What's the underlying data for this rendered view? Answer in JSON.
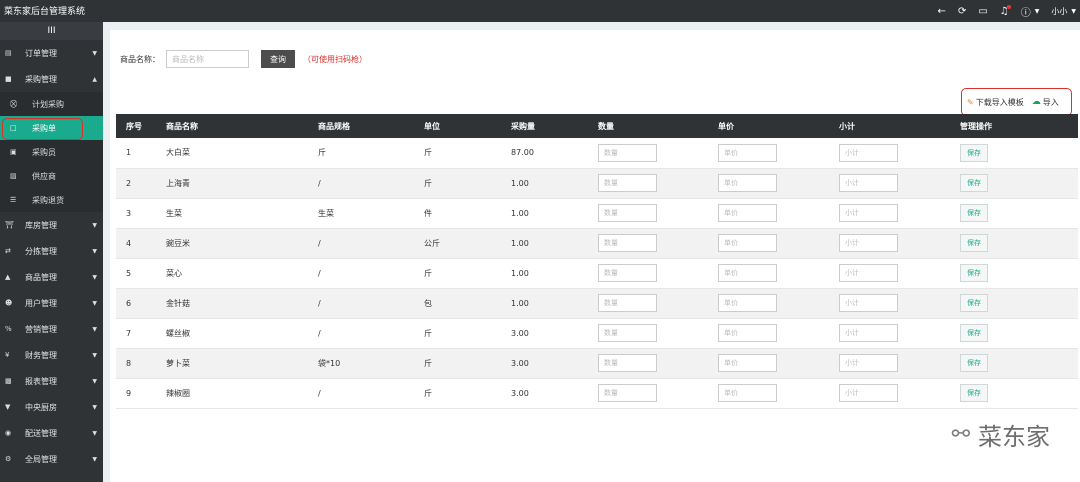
{
  "app": {
    "title": "菜东家后台管理系统"
  },
  "topbar": {
    "user": "小小",
    "icons": [
      "back-arrow-icon",
      "refresh-icon",
      "monitor-icon",
      "bell-icon",
      "info-icon"
    ]
  },
  "sidebar": {
    "toggle": "III",
    "items": [
      {
        "icon": "clipboard-icon",
        "label": "订单管理",
        "expanded": false
      },
      {
        "icon": "bag-icon",
        "label": "采购管理",
        "expanded": true,
        "children": [
          {
            "icon": "cart-icon",
            "label": "计划采购"
          },
          {
            "icon": "calendar-icon",
            "label": "采购单",
            "active": true
          },
          {
            "icon": "id-card-icon",
            "label": "采购员"
          },
          {
            "icon": "truck-icon",
            "label": "供应商"
          },
          {
            "icon": "list-icon",
            "label": "采购退货"
          }
        ]
      },
      {
        "icon": "bank-icon",
        "label": "库房管理"
      },
      {
        "icon": "shuffle-icon",
        "label": "分拣管理"
      },
      {
        "icon": "store-icon",
        "label": "商品管理"
      },
      {
        "icon": "users-icon",
        "label": "用户管理"
      },
      {
        "icon": "percent-icon",
        "label": "营销管理"
      },
      {
        "icon": "yuan-icon",
        "label": "财务管理"
      },
      {
        "icon": "chart-icon",
        "label": "报表管理"
      },
      {
        "icon": "filter-icon",
        "label": "中央厨房"
      },
      {
        "icon": "car-icon",
        "label": "配送管理"
      },
      {
        "icon": "gears-icon",
        "label": "全局管理"
      }
    ]
  },
  "search": {
    "label": "商品名称：",
    "placeholder": "商品名称",
    "button": "查询",
    "hint": "（可使用扫码枪）"
  },
  "actions": {
    "download": "下载导入模板",
    "import": "导入"
  },
  "table": {
    "headers": [
      "序号",
      "商品名称",
      "商品规格",
      "单位",
      "采购量",
      "数量",
      "单价",
      "小计",
      "管理操作"
    ],
    "placeholders": {
      "qty": "数量",
      "price": "单价",
      "subtotal": "小计"
    },
    "save_label": "保存",
    "rows": [
      {
        "no": "1",
        "name": "大白菜",
        "spec": "斤",
        "unit": "斤",
        "amount": "87.00"
      },
      {
        "no": "2",
        "name": "上海青",
        "spec": "/",
        "unit": "斤",
        "amount": "1.00"
      },
      {
        "no": "3",
        "name": "生菜",
        "spec": "生菜",
        "unit": "件",
        "amount": "1.00"
      },
      {
        "no": "4",
        "name": "豌豆米",
        "spec": "/",
        "unit": "公斤",
        "amount": "1.00"
      },
      {
        "no": "5",
        "name": "菜心",
        "spec": "/",
        "unit": "斤",
        "amount": "1.00"
      },
      {
        "no": "6",
        "name": "金针菇",
        "spec": "/",
        "unit": "包",
        "amount": "1.00"
      },
      {
        "no": "7",
        "name": "螺丝椒",
        "spec": "/",
        "unit": "斤",
        "amount": "3.00"
      },
      {
        "no": "8",
        "name": "萝卜菜",
        "spec": "袋*10",
        "unit": "斤",
        "amount": "3.00"
      },
      {
        "no": "9",
        "name": "辣椒圈",
        "spec": "/",
        "unit": "斤",
        "amount": "3.00"
      }
    ]
  },
  "watermark": {
    "text": "菜东家",
    "icon": "wechat-icon"
  }
}
